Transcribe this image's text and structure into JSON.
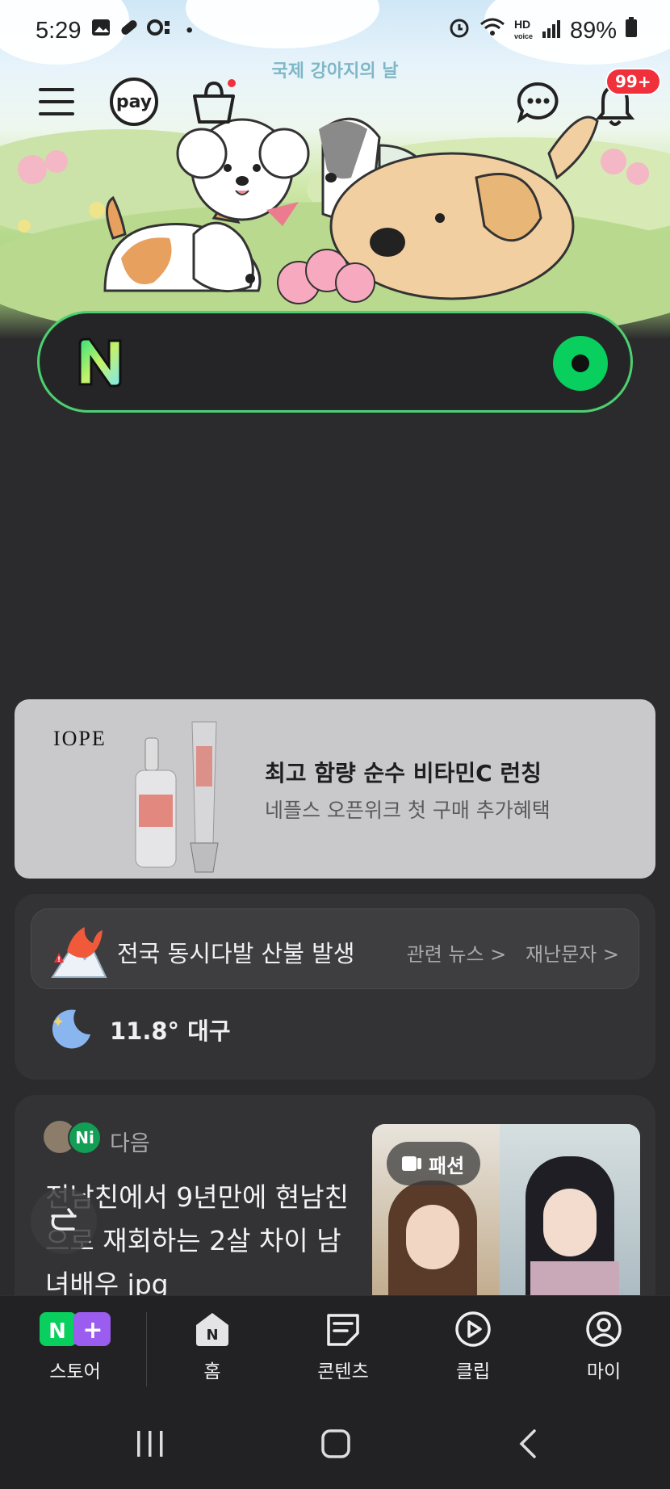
{
  "status_bar": {
    "time": "5:29",
    "battery": "89%",
    "more_indicator": "•"
  },
  "event": {
    "title": "국제 강아지의 날"
  },
  "header": {
    "pay_label": "pay",
    "notification_badge": "99+"
  },
  "ad": {
    "brand": "IOPE",
    "headline": "최고 함량 순수 비타민C 런칭",
    "subtext": "네플스 오픈위크 첫 구매 추가혜택"
  },
  "alert": {
    "title": "전국 동시다발 산불 발생",
    "link_news": "관련 뉴스 >",
    "link_msg": "재난문자 >"
  },
  "weather": {
    "text": "11.8° 대구"
  },
  "feed": {
    "source": "다음",
    "headline": "전남친에서 9년만에 현남친으로 재회하는 2살 차이 남녀배우 jpg",
    "badge": "패션"
  },
  "bottom_nav": {
    "items": [
      {
        "label": "스토어",
        "icon": "store-icon"
      },
      {
        "label": "홈",
        "icon": "home-icon"
      },
      {
        "label": "콘텐츠",
        "icon": "contents-icon"
      },
      {
        "label": "클립",
        "icon": "clip-icon"
      },
      {
        "label": "마이",
        "icon": "profile-icon"
      }
    ]
  },
  "colors": {
    "accent": "#08cf5d",
    "alert_red": "#f0303b",
    "background": "#2b2b2d"
  }
}
